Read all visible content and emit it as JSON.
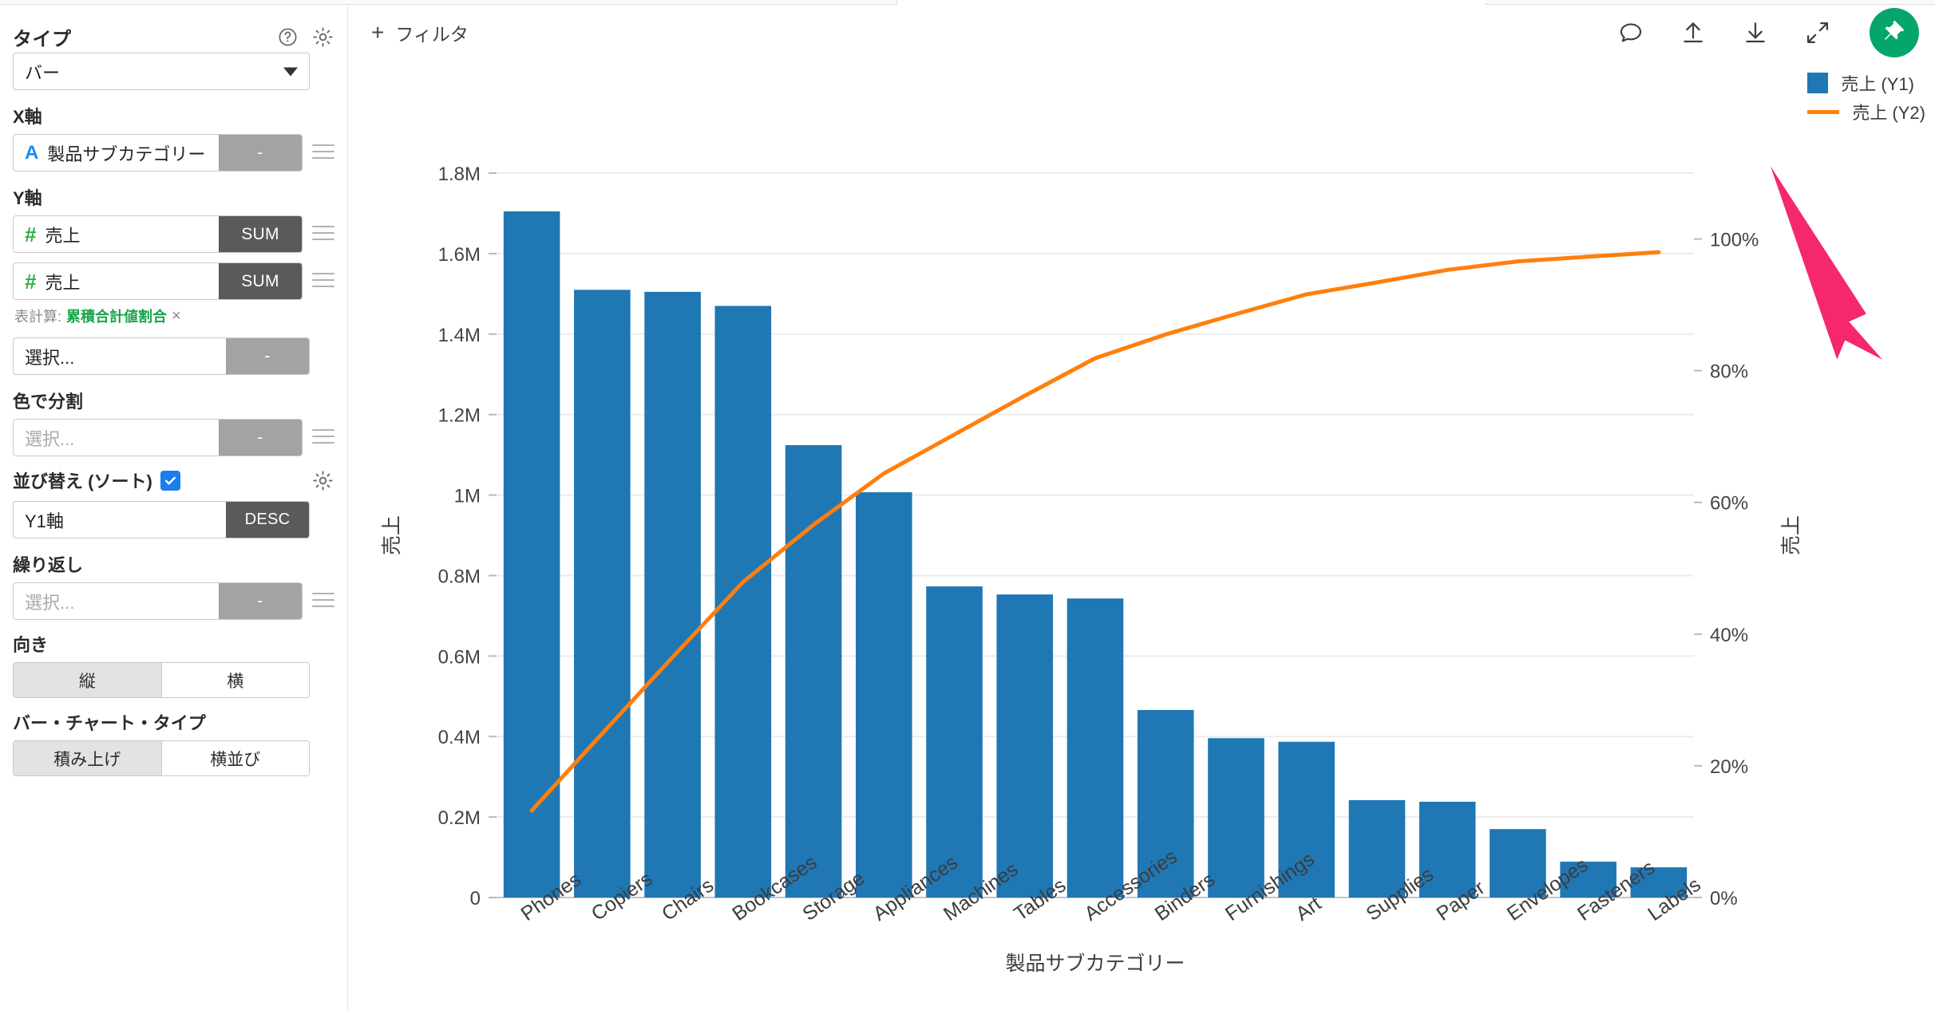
{
  "sidebar": {
    "type_section": {
      "title": "タイプ",
      "help_icon": "question-circle-icon",
      "gear_icon": "gear-icon",
      "value": "バー"
    },
    "x_axis": {
      "label": "X軸",
      "field": "製品サブカテゴリー",
      "field_type_glyph": "A",
      "agg": "-"
    },
    "y_axis": {
      "label": "Y軸",
      "fields": [
        {
          "field": "売上",
          "field_type_glyph": "#",
          "agg": "SUM"
        },
        {
          "field": "売上",
          "field_type_glyph": "#",
          "agg": "SUM"
        }
      ],
      "table_calc_prefix": "表計算:",
      "table_calc_value": "累積合計値割合",
      "table_calc_remove": "×",
      "placeholder_field": "選択...",
      "placeholder_agg": "-"
    },
    "color_split": {
      "label": "色で分割",
      "placeholder_field": "選択...",
      "placeholder_agg": "-"
    },
    "sort": {
      "label": "並び替え (ソート)",
      "checked": true,
      "gear_icon": "gear-icon",
      "field": "Y1軸",
      "direction": "DESC"
    },
    "repeat": {
      "label": "繰り返し",
      "placeholder_field": "選択...",
      "placeholder_agg": "-"
    },
    "orientation": {
      "label": "向き",
      "options": [
        "縦",
        "横"
      ],
      "selected_index": 0
    },
    "bar_chart_type": {
      "label": "バー・チャート・タイプ",
      "options": [
        "積み上げ",
        "横並び"
      ],
      "selected_index": 0
    }
  },
  "topbar": {
    "filter_label": "フィルタ",
    "plus_icon": "plus-icon",
    "icons": [
      "comment-icon",
      "upload-icon",
      "download-icon",
      "expand-icon"
    ],
    "pin_icon": "pin-icon",
    "pin_color": "#05a66b"
  },
  "annotation": {
    "arrow_icon": "pink-arrow-icon",
    "color": "#f5286c"
  },
  "chart_data": {
    "type": "bar",
    "title": "",
    "categories": [
      "Phones",
      "Copiers",
      "Chairs",
      "Bookcases",
      "Storage",
      "Appliances",
      "Machines",
      "Tables",
      "Accessories",
      "Binders",
      "Furnishings",
      "Art",
      "Supplies",
      "Paper",
      "Envelopes",
      "Fasteners",
      "Labels"
    ],
    "series": [
      {
        "name": "売上 (Y1)",
        "type": "bar",
        "axis": "y1",
        "color": "#1f77b4",
        "values": [
          1705000,
          1510000,
          1505000,
          1470000,
          1124000,
          1007000,
          773000,
          753000,
          743000,
          466000,
          396000,
          387000,
          242000,
          238000,
          170000,
          89000,
          75000
        ]
      },
      {
        "name": "売上 (Y2)",
        "type": "line",
        "axis": "y2",
        "color": "#ff7f0e",
        "values": [
          13.2,
          24.9,
          36.5,
          47.9,
          56.6,
          64.4,
          70.3,
          76.2,
          81.9,
          85.5,
          88.6,
          91.6,
          93.4,
          95.3,
          96.6,
          97.3,
          98.0
        ]
      }
    ],
    "xlabel": "製品サブカテゴリー",
    "ylabel": "売上",
    "y2label": "売上",
    "yticks": [
      "0",
      "0.2M",
      "0.4M",
      "0.6M",
      "0.8M",
      "1M",
      "1.2M",
      "1.4M",
      "1.6M",
      "1.8M"
    ],
    "ytick_values": [
      0,
      200000,
      400000,
      600000,
      800000,
      1000000,
      1200000,
      1400000,
      1600000,
      1800000
    ],
    "ylim": [
      0,
      1800000
    ],
    "y2ticks": [
      "0%",
      "20%",
      "40%",
      "60%",
      "80%",
      "100%"
    ],
    "y2tick_values": [
      0,
      20,
      40,
      60,
      80,
      100
    ],
    "y2lim": [
      0,
      110
    ],
    "grid": true,
    "legend_position": "top-right",
    "xtick_rotation": -35
  }
}
